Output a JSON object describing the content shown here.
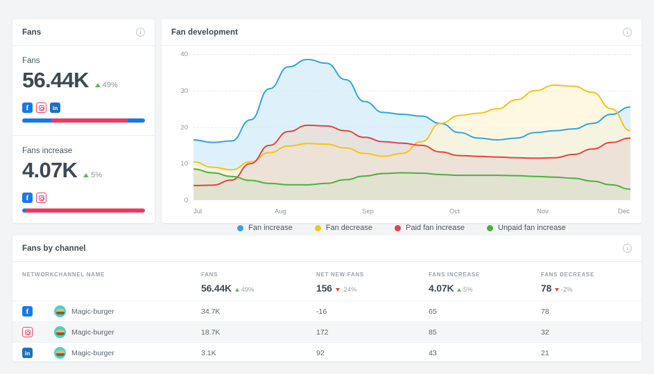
{
  "fans_card": {
    "title": "Fans",
    "info_icon": "info-icon",
    "blocks": [
      {
        "label": "Fans",
        "value": "56.44K",
        "delta": "49%",
        "delta_dir": "up",
        "channels": [
          "facebook",
          "instagram",
          "linkedin"
        ],
        "bar": [
          {
            "color": "#1877f2",
            "pct": 24
          },
          {
            "color": "#ef3a60",
            "pct": 62
          },
          {
            "color": "#1877f2",
            "pct": 14
          }
        ]
      },
      {
        "label": "Fans increase",
        "value": "4.07K",
        "delta": "5%",
        "delta_dir": "up",
        "channels": [
          "facebook",
          "instagram"
        ],
        "bar": [
          {
            "color": "#1877f2",
            "pct": 3
          },
          {
            "color": "#ef3a60",
            "pct": 97
          }
        ]
      }
    ]
  },
  "chart_card": {
    "title": "Fan development",
    "info_icon": "info-icon"
  },
  "chart_data": {
    "type": "area",
    "title": "Fan development",
    "xlabel": "",
    "ylabel": "",
    "ylim": [
      0,
      40
    ],
    "yticks": [
      0,
      10,
      20,
      30,
      40
    ],
    "grid": true,
    "legend_position": "bottom",
    "categories": [
      "Jul",
      "Aug",
      "Sep",
      "Oct",
      "Nov",
      "Dec"
    ],
    "x": [
      0,
      1,
      2,
      3,
      4,
      5
    ],
    "series": [
      {
        "name": "Fan increase",
        "color": "#2fa4e7",
        "fill": "#d3ecfa",
        "values": [
          16.5,
          38.5,
          23,
          16.5,
          19,
          25.5
        ],
        "dense": [
          16.5,
          15.8,
          16.2,
          22,
          30.5,
          36.5,
          38.5,
          37.5,
          33,
          27,
          24,
          23.5,
          23,
          21,
          18.5,
          17,
          16.5,
          17,
          18.5,
          19,
          19.5,
          21,
          23.5,
          25.5
        ]
      },
      {
        "name": "Fan decrease",
        "color": "#f6c317",
        "fill": "#fdf4d7",
        "values": [
          10.5,
          15.5,
          12,
          23.5,
          31.5,
          19
        ],
        "dense": [
          10.5,
          9,
          8.3,
          10.5,
          13,
          14.8,
          15.5,
          15.3,
          14.3,
          12.8,
          12,
          12.8,
          16,
          21,
          23.2,
          23.8,
          25,
          27.5,
          30,
          31.5,
          31.2,
          29.5,
          25,
          19
        ]
      },
      {
        "name": "Paid fan increase",
        "color": "#e8413b",
        "fill": "#e8dcd4",
        "values": [
          4,
          20.5,
          15,
          12,
          11.5,
          17
        ],
        "dense": [
          4,
          4.1,
          5.5,
          10,
          15,
          18.8,
          20.5,
          20.3,
          19,
          17.2,
          16,
          15.6,
          15,
          13.2,
          12.2,
          12,
          11.8,
          11.6,
          11.5,
          11.6,
          12.5,
          14,
          15.8,
          17
        ]
      },
      {
        "name": "Unpaid fan increase",
        "color": "#4caf3f",
        "fill": "#dde2cd",
        "values": [
          8.5,
          4.2,
          7.5,
          6.8,
          6.5,
          3
        ],
        "dense": [
          8.5,
          7.5,
          6.5,
          5.4,
          4.6,
          4.2,
          4.2,
          4.6,
          5.6,
          6.6,
          7.3,
          7.5,
          7.4,
          7,
          6.8,
          6.8,
          6.8,
          6.7,
          6.5,
          6.3,
          6,
          5.2,
          4.2,
          3
        ]
      }
    ]
  },
  "table_card": {
    "title": "Fans by channel",
    "info_icon": "info-icon",
    "columns": [
      {
        "key": "network",
        "header": "NETWORK"
      },
      {
        "key": "name",
        "header": "CHANNEL NAME"
      },
      {
        "key": "fans",
        "header": "FANS",
        "summary": "56.44K",
        "delta": "49%",
        "dir": "up"
      },
      {
        "key": "net_new",
        "header": "NET NEW FANS",
        "summary": "156",
        "delta": "-24%",
        "dir": "down"
      },
      {
        "key": "increase",
        "header": "FANS INCREASE",
        "summary": "4.07K",
        "delta": "5%",
        "dir": "up"
      },
      {
        "key": "decrease",
        "header": "FANS DECREASE",
        "summary": "78",
        "delta": "-2%",
        "dir": "down"
      }
    ],
    "rows": [
      {
        "network": "facebook",
        "name": "Magic-burger",
        "fans": "34.7K",
        "net_new": "-16",
        "increase": "65",
        "decrease": "78"
      },
      {
        "network": "instagram",
        "name": "Magic-burger",
        "fans": "18.7K",
        "net_new": "172",
        "increase": "85",
        "decrease": "32"
      },
      {
        "network": "linkedin",
        "name": "Magic-burger",
        "fans": "3.1K",
        "net_new": "92",
        "increase": "43",
        "decrease": "21"
      }
    ]
  },
  "colors": {
    "background": "#f2f4f6",
    "card": "#ffffff",
    "text": "#3d4852",
    "muted": "#8b949c",
    "up": "#5cb85c",
    "down": "#e8413b",
    "facebook": "#1877f2",
    "instagram": "#ef3a60",
    "linkedin": "#1c71c0"
  }
}
